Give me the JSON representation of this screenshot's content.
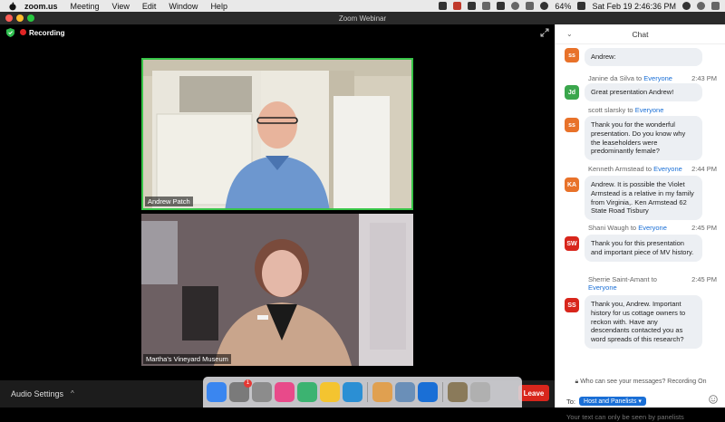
{
  "menubar": {
    "app": "zoom.us",
    "menus": [
      "Meeting",
      "View",
      "Edit",
      "Window",
      "Help"
    ],
    "battery": "64%",
    "datetime": "Sat Feb 19  2:46:36 PM"
  },
  "window": {
    "title": "Zoom Webinar"
  },
  "video": {
    "recording_label": "Recording",
    "tiles": [
      {
        "name": "Andrew Patch"
      },
      {
        "name": "Martha's Vineyard Museum"
      }
    ]
  },
  "controls": {
    "audio_settings": "Audio Settings",
    "caret": "^",
    "leave": "Leave"
  },
  "dock": {
    "badge": "1",
    "colors": [
      "#3a86f0",
      "#7a7a7a",
      "#8c8c8c",
      "#e84a8a",
      "#3cb371",
      "#f4c430",
      "#2b8fd4",
      "#e0a050",
      "#6a8fb8",
      "#1a6fd6",
      "#8a7a5a",
      "#b0b0b0"
    ]
  },
  "chat": {
    "title": "Chat",
    "messages": [
      {
        "initials": "ss",
        "color": "#e8722a",
        "text": "Andrew:",
        "sender": "",
        "to": "",
        "time": ""
      },
      {
        "initials": "Jd",
        "color": "#3aa64c",
        "sender": "Janine da Silva to ",
        "to": "Everyone",
        "time": "2:43 PM",
        "text": "Great presentation Andrew!"
      },
      {
        "initials": "ss",
        "color": "#e8722a",
        "sender": "scott slarsky to ",
        "to": "Everyone",
        "time": "",
        "text": "Thank you for the wonderful presentation.  Do you know why the leaseholders were predominantly female?"
      },
      {
        "initials": "KA",
        "color": "#e8722a",
        "sender": "Kenneth Armstead to ",
        "to": "Everyone",
        "time": "2:44 PM",
        "text": "Andrew. It is possible the Violet Armstead is a relative in my family from Virginia,. Ken Armstead 62 State Road Tisbury"
      },
      {
        "initials": "SW",
        "color": "#d8261c",
        "sender": "Shani Waugh to ",
        "to": "Everyone",
        "time": "2:45 PM",
        "text": "Thank you for this presentation and important piece of MV history."
      },
      {
        "initials": "SS",
        "color": "#d8261c",
        "sender": "Sherrie Saint-Amant to ",
        "to": "Everyone",
        "time": "2:45 PM",
        "text": "Thank you, Andrew. Important history for us cottage owners to reckon with. Have any descendants contacted you as word spreads of this research?"
      }
    ],
    "privacy": "Who can see your messages? Recording On",
    "to_label": "To:",
    "to_value": "Host and Panelists",
    "input_placeholder": "Your text can only be seen by panelists"
  }
}
